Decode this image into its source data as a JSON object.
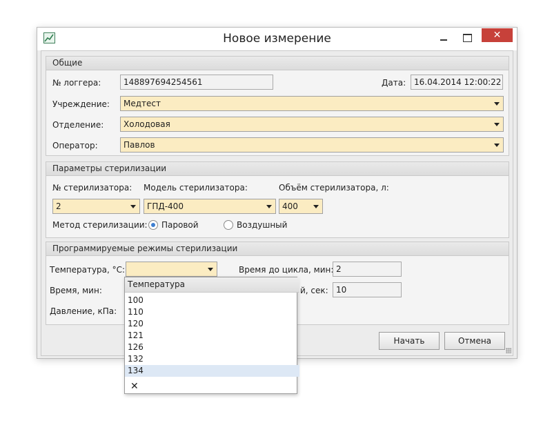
{
  "window": {
    "title": "Новое измерение",
    "close_glyph": "✕"
  },
  "general": {
    "header": "Общие",
    "logger_label": "№ логгера:",
    "logger_value": "148897694254561",
    "date_label": "Дата:",
    "date_value": "16.04.2014 12:00:22",
    "institution_label": "Учреждение:",
    "institution_value": "Медтест",
    "department_label": "Отделение:",
    "department_value": "Холодовая",
    "operator_label": "Оператор:",
    "operator_value": "Павлов"
  },
  "sterilization": {
    "header": "Параметры стерилизации",
    "number_label": "№ стерилизатора:",
    "number_value": "2",
    "model_label": "Модель стерилизатора:",
    "model_value": "ГПД-400",
    "volume_label": "Объём стерилизатора, л:",
    "volume_value": "400",
    "method_label": "Метод стерилизации:",
    "method_options": [
      "Паровой",
      "Воздушный"
    ],
    "method_selected": "Паровой"
  },
  "programs": {
    "header": "Программируемые режимы стерилизации",
    "temperature_label": "Температура, °С:",
    "temperature_value": "",
    "time_label": "Время, мин:",
    "pressure_label": "Давление, кПа:",
    "time_to_cycle_label": "Время до цикла, мин:",
    "time_to_cycle_value": "2",
    "partial_label": "й, сек:",
    "partial_value": "10"
  },
  "buttons": {
    "start": "Начать",
    "cancel": "Отмена"
  },
  "dropdown": {
    "header": "Температура",
    "options": [
      "100",
      "110",
      "120",
      "121",
      "126",
      "132",
      "134"
    ],
    "highlighted": "134",
    "clear_glyph": "✕"
  }
}
